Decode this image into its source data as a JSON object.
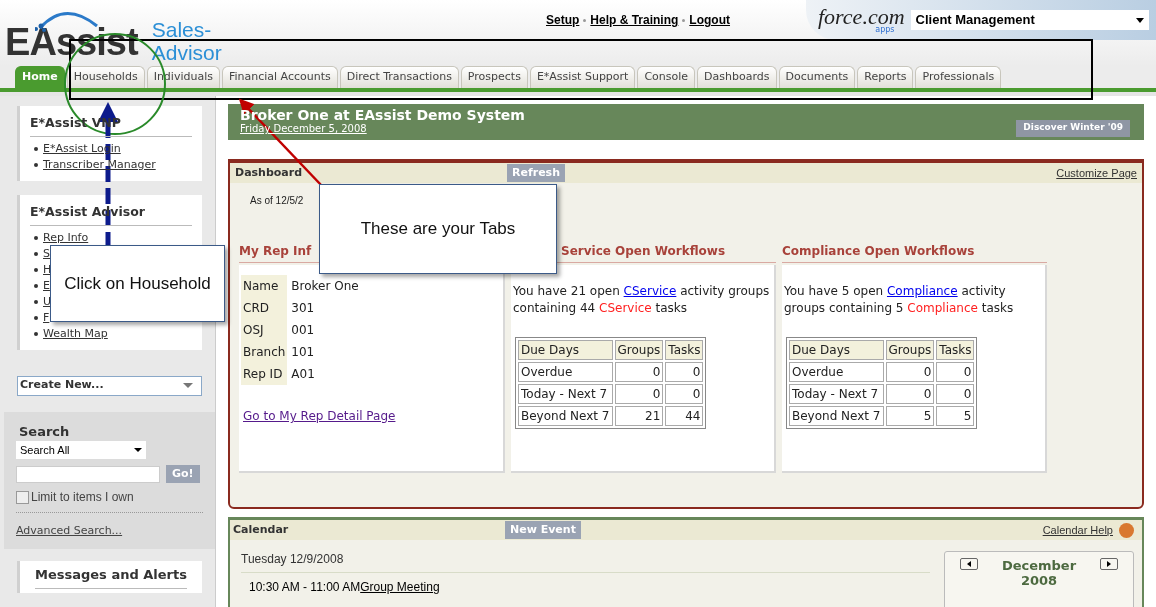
{
  "logo": {
    "brand": "EAssist",
    "product_line1": "Sales-",
    "product_line2": "Advisor"
  },
  "top_links": [
    "Setup",
    "Help & Training",
    "Logout"
  ],
  "platform_logo": {
    "name": "force.com",
    "sub": "apps"
  },
  "app_picker": {
    "value": "Client Management"
  },
  "tabs": [
    {
      "label": "Home",
      "selected": true
    },
    {
      "label": "Households",
      "selected": false
    },
    {
      "label": "Individuals",
      "selected": false
    },
    {
      "label": "Financial Accounts",
      "selected": false
    },
    {
      "label": "Direct Transactions",
      "selected": false
    },
    {
      "label": "Prospects",
      "selected": false
    },
    {
      "label": "E*Assist Support",
      "selected": false
    },
    {
      "label": "Console",
      "selected": false
    },
    {
      "label": "Dashboards",
      "selected": false
    },
    {
      "label": "Documents",
      "selected": false
    },
    {
      "label": "Reports",
      "selected": false
    },
    {
      "label": "Professionals",
      "selected": false
    }
  ],
  "sidebar": {
    "panels": [
      {
        "title": "E*Assist VNP",
        "links": [
          "E*Assist Login",
          "Transcriber Manager"
        ]
      },
      {
        "title": "E*Assist Advisor",
        "links": [
          "Rep Info",
          "S",
          "H",
          "E",
          "U",
          "F",
          "Wealth Map"
        ]
      }
    ],
    "create_new": "Create New...",
    "search": {
      "title": "Search",
      "scope": "Search All",
      "button": "Go!",
      "limit_label": "Limit to items I own",
      "limit_checked": false,
      "advanced": "Advanced Search..."
    },
    "messages_title": "Messages and Alerts"
  },
  "banner": {
    "title": "Broker One at EAssist Demo System",
    "date": "Friday December 5, 2008",
    "button": "Discover Winter '09"
  },
  "dashboard": {
    "title": "Dashboard",
    "refresh": "Refresh",
    "customize": "Customize Page",
    "as_of": "As of 12/5/2",
    "rep_info": {
      "title": "My Rep Inf",
      "rows": [
        {
          "label": "Name",
          "value": "Broker One"
        },
        {
          "label": "CRD",
          "value": "301"
        },
        {
          "label": "OSJ",
          "value": "001"
        },
        {
          "label": "Branch",
          "value": "101"
        },
        {
          "label": "Rep ID",
          "value": "A01"
        }
      ],
      "link": "Go to My Rep Detail Page"
    },
    "workflows": [
      {
        "title": "Service Open Workflows",
        "text": {
          "before": "You have 21 open ",
          "link": "CService",
          "middle": " activity groups containing 44 ",
          "highlight": "CService",
          "after": " tasks"
        },
        "columns": [
          "Due Days",
          "Groups",
          "Tasks"
        ],
        "rows": [
          [
            "Overdue",
            "0",
            "0"
          ],
          [
            "Today - Next 7",
            "0",
            "0"
          ],
          [
            "Beyond Next 7",
            "21",
            "44"
          ]
        ]
      },
      {
        "title": "Compliance Open Workflows",
        "text": {
          "before": "You have 5 open ",
          "link": "Compliance",
          "middle": " activity groups containing 5 ",
          "highlight": "Compliance",
          "after": " tasks"
        },
        "columns": [
          "Due Days",
          "Groups",
          "Tasks"
        ],
        "rows": [
          [
            "Overdue",
            "0",
            "0"
          ],
          [
            "Today - Next 7",
            "0",
            "0"
          ],
          [
            "Beyond Next 7",
            "5",
            "5"
          ]
        ]
      }
    ]
  },
  "calendar": {
    "title": "Calendar",
    "new_event": "New Event",
    "help": "Calendar Help",
    "day": "Tuesday 12/9/2008",
    "event_time": "10:30 AM - 11:00 AM",
    "event_link": "Group Meeting",
    "month": "December",
    "year": "2008"
  },
  "callouts": [
    {
      "text": "These are your Tabs"
    },
    {
      "text": "Click on Household"
    }
  ]
}
